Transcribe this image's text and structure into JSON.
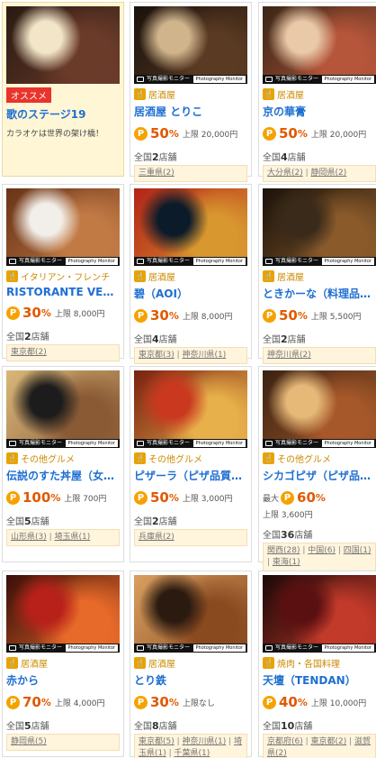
{
  "photo_bar": {
    "label": "写真撮影モニター",
    "badge": "Photography Monitor"
  },
  "cards": [
    {
      "kind": "featured",
      "badge": "オススメ",
      "title": "歌のステージ19",
      "desc": "カラオケは世界の架け橋！",
      "art": [
        "#f3e6c8",
        "#6b3b2a",
        "#2a1a12"
      ]
    },
    {
      "category": "居酒屋",
      "title": "居酒屋 とりこ",
      "pct": "50",
      "pct_unit": "%",
      "cap": "上限 20,000円",
      "stores_prefix": "全国",
      "stores_num": "2",
      "stores_suffix": "店舗",
      "areas": [
        "三重県(2)"
      ],
      "art": [
        "#d0b48c",
        "#5a3a22",
        "#1b120c"
      ]
    },
    {
      "category": "居酒屋",
      "title": "京の華膏",
      "pct": "50",
      "pct_unit": "%",
      "cap": "上限 20,000円",
      "stores_prefix": "全国",
      "stores_num": "4",
      "stores_suffix": "店舗",
      "areas": [
        "大分県(2)",
        "静岡県(2)"
      ],
      "art": [
        "#e9c9a8",
        "#b5553a",
        "#3a2616"
      ]
    },
    {
      "category": "イタリアン・フレンチ",
      "title": "RISTORANTE VENI…",
      "pct": "30",
      "pct_unit": "%",
      "cap": "上限 8,000円",
      "stores_prefix": "全国",
      "stores_num": "2",
      "stores_suffix": "店舗",
      "areas": [
        "東京都(2)"
      ],
      "art": [
        "#f2efea",
        "#c27a45",
        "#6a3418"
      ]
    },
    {
      "category": "居酒屋",
      "title": "碧（AOI）",
      "pct": "30",
      "pct_unit": "%",
      "cap": "上限 8,000円",
      "stores_prefix": "全国",
      "stores_num": "4",
      "stores_suffix": "店舗",
      "areas": [
        "東京都(3)",
        "神奈川県(1)"
      ],
      "art": [
        "#0b1b2a",
        "#d9972f",
        "#b32418"
      ]
    },
    {
      "category": "居酒屋",
      "title": "ときかーな（料理品質調…",
      "pct": "50",
      "pct_unit": "%",
      "cap": "上限 5,500円",
      "stores_prefix": "全国",
      "stores_num": "2",
      "stores_suffix": "店舗",
      "areas": [
        "神奈川県(2)"
      ],
      "art": [
        "#3a2a1a",
        "#8a5a2a",
        "#1a120a"
      ]
    },
    {
      "category": "その他グルメ",
      "title": "伝説のすた丼屋（女性専…",
      "pct": "100",
      "pct_unit": "%",
      "cap": "上限 700円",
      "stores_prefix": "全国",
      "stores_num": "5",
      "stores_suffix": "店舗",
      "areas": [
        "山形県(3)",
        "埼玉県(1)"
      ],
      "art": [
        "#1c1c1c",
        "#8a5a35",
        "#d9b77a"
      ]
    },
    {
      "category": "その他グルメ",
      "title": "ピザーラ（ピザ品質調査…",
      "pct": "50",
      "pct_unit": "%",
      "cap": "上限 3,000円",
      "stores_prefix": "全国",
      "stores_num": "2",
      "stores_suffix": "店舗",
      "areas": [
        "兵庫県(2)"
      ],
      "art": [
        "#c9381f",
        "#e8b04a",
        "#7a2010"
      ]
    },
    {
      "category": "その他グルメ",
      "title": "シカゴピザ（ピザ品質調…",
      "pct_prefix": "最大",
      "pct": "60",
      "pct_unit": "%",
      "cap": "上限 3,600円",
      "stores_prefix": "全国",
      "stores_num": "36",
      "stores_suffix": "店舗",
      "areas": [
        "関西(28)",
        "中国(6)",
        "四国(1)",
        "東海(1)"
      ],
      "art": [
        "#e6b978",
        "#a6582a",
        "#3a2212"
      ]
    },
    {
      "category": "居酒屋",
      "title": "赤から",
      "pct": "70",
      "pct_unit": "%",
      "cap": "上限 4,000円",
      "stores_prefix": "全国",
      "stores_num": "5",
      "stores_suffix": "店舗",
      "areas": [
        "静岡県(5)"
      ],
      "art": [
        "#b8201a",
        "#e86a2a",
        "#3a0e08"
      ]
    },
    {
      "category": "居酒屋",
      "title": "とり鉄",
      "pct": "30",
      "pct_unit": "%",
      "cap": "上限なし",
      "stores_prefix": "全国",
      "stores_num": "8",
      "stores_suffix": "店舗",
      "areas": [
        "東京都(5)",
        "神奈川県(1)",
        "埼玉県(1)",
        "千葉県(1)"
      ],
      "art": [
        "#2a1a10",
        "#8a4a20",
        "#d9a060"
      ]
    },
    {
      "category": "焼肉・各国料理",
      "title": "天壇（TENDAN）",
      "pct": "40",
      "pct_unit": "%",
      "cap": "上限 10,000円",
      "stores_prefix": "全国",
      "stores_num": "10",
      "stores_suffix": "店舗",
      "areas": [
        "京都府(6)",
        "東京都(2)",
        "滋賀県(2)"
      ],
      "art": [
        "#5a1010",
        "#c23a2a",
        "#1a0808"
      ]
    }
  ]
}
